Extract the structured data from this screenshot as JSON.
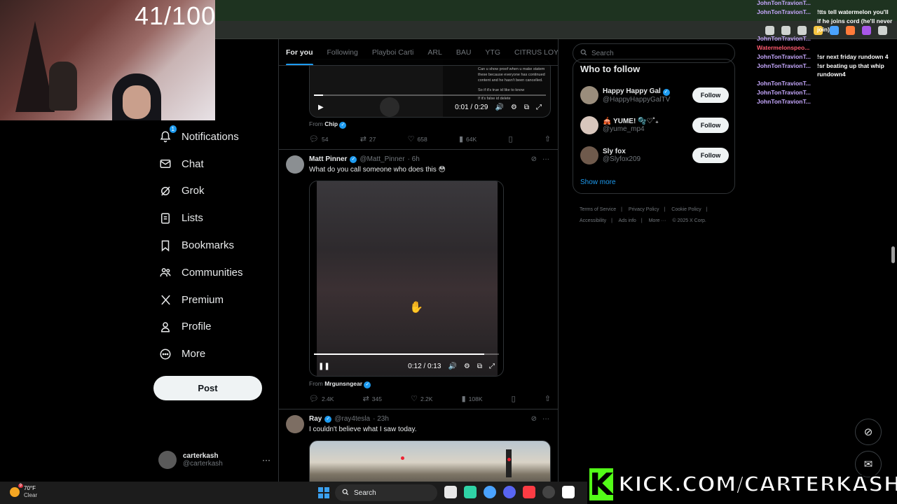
{
  "stream": {
    "counter": "41/100",
    "kick_banner": "KICK.COM/CARTERKASH",
    "kick_logo": "K"
  },
  "chat": [
    {
      "user": "JohnTonTravionT...",
      "message": "",
      "color": "#c7a9ff"
    },
    {
      "user": "JohnTonTravionT...",
      "message": "!tts tell watermelon you'll",
      "color": "#c7a9ff"
    },
    {
      "user": "",
      "message": "if he joins cord (he'll never",
      "color": "#c7a9ff"
    },
    {
      "user": "",
      "message": "join)",
      "color": "#c7a9ff"
    },
    {
      "user": "JohnTonTravionT...",
      "message": "",
      "color": "#c7a9ff"
    },
    {
      "user": "Watermelonspeo...",
      "message": "",
      "color": "#ff5a6e"
    },
    {
      "user": "JohnTonTravionT...",
      "message": "!sr next friday rundown 4",
      "color": "#c7a9ff"
    },
    {
      "user": "JohnTonTravionT...",
      "message": "!sr beating up that whip",
      "color": "#c7a9ff"
    },
    {
      "user": "",
      "message": "rundown4",
      "color": "#c7a9ff"
    },
    {
      "user": "JohnTonTravionT...",
      "message": "",
      "color": "#c7a9ff"
    },
    {
      "user": "JohnTonTravionT...",
      "message": "",
      "color": "#c7a9ff"
    },
    {
      "user": "JohnTonTravionT...",
      "message": "",
      "color": "#c7a9ff"
    }
  ],
  "nav": {
    "items": [
      {
        "label": "Notifications",
        "icon": "bell-icon",
        "badge": "1"
      },
      {
        "label": "Chat",
        "icon": "mail-icon"
      },
      {
        "label": "Grok",
        "icon": "grok-icon"
      },
      {
        "label": "Lists",
        "icon": "list-icon"
      },
      {
        "label": "Bookmarks",
        "icon": "bookmark-icon"
      },
      {
        "label": "Communities",
        "icon": "people-icon"
      },
      {
        "label": "Premium",
        "icon": "x-logo-icon"
      },
      {
        "label": "Profile",
        "icon": "person-icon"
      },
      {
        "label": "More",
        "icon": "more-circle-icon"
      }
    ],
    "post_label": "Post",
    "account": {
      "name": "carterkash",
      "handle": "@carterkash",
      "more": "···"
    }
  },
  "tabs": [
    "For you",
    "Following",
    "Playboi Carti",
    "ARL",
    "BAU",
    "YTG",
    "CITRUS LOYA"
  ],
  "tweets": [
    {
      "video_time": "0:01 / 0:29",
      "video_progress": 0.04,
      "screen_text": [
        "Can u show proof when u make statem",
        "these because everyone has continued",
        "content and he hasn't been cancelled.",
        "So if it's true id like to know",
        "If it's false id delete"
      ],
      "from_label": "From",
      "from_name": "Chip",
      "replies": "54",
      "reposts": "27",
      "likes": "658",
      "views": "64K"
    },
    {
      "name": "Matt Pinner",
      "handle": "@Matt_Pinner",
      "time": "· 6h",
      "text": "What do you call someone who does this 😳",
      "video_time": "0:12 / 0:13",
      "video_progress": 0.92,
      "from_label": "From",
      "from_name": "Mrgunsngear",
      "replies": "2.4K",
      "reposts": "345",
      "likes": "2.2K",
      "views": "108K"
    },
    {
      "name": "Ray",
      "handle": "@ray4tesla",
      "time": "· 23h",
      "text": "I couldn't believe what I saw today."
    }
  ],
  "sidebar_right": {
    "search_placeholder": "Search",
    "who_to_follow": "Who to follow",
    "follow_label": "Follow",
    "accounts": [
      {
        "name": "Happy Happy Gal",
        "handle": "@HappyHappyGalTV",
        "verified": true
      },
      {
        "name": "🎪 YUME! 🫧♡˚₊",
        "handle": "@yume_mp4",
        "verified": false
      },
      {
        "name": "Sly fox",
        "handle": "@Slyfox209",
        "verified": false
      }
    ],
    "show_more": "Show more",
    "footer": [
      "Terms of Service",
      "|",
      "Privacy Policy",
      "|",
      "Cookie Policy",
      "|",
      "Accessibility",
      "|",
      "Ads info",
      "|",
      "More ···",
      "© 2025 X Corp."
    ]
  },
  "taskbar": {
    "temp": "70°F",
    "condition": "Clear",
    "weather_badge": "9",
    "search_label": "Search"
  },
  "colors": {
    "accent": "#1d9bf0",
    "kick_green": "#53fc18",
    "chat_user": "#c7a9ff",
    "chat_user_alt": "#ff5a6e"
  }
}
